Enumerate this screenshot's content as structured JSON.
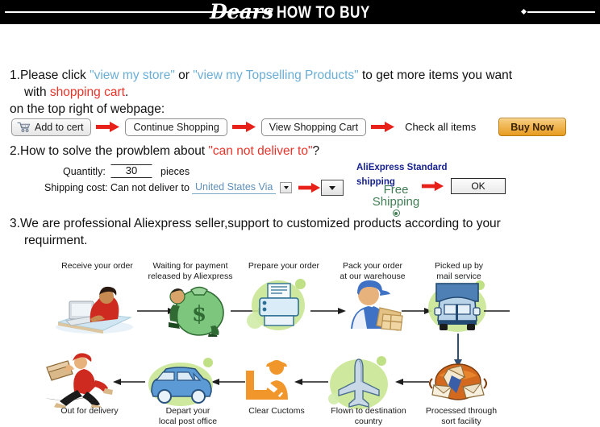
{
  "header": {
    "brand": "Dears",
    "title": "HOW TO BUY",
    "bg_color": "#000000",
    "text_color": "#ffffff"
  },
  "colors": {
    "link_blue": "#6aaed6",
    "accent_red": "#e8332a",
    "buy_now_orange": "#e79b21",
    "green": "#3f7d53",
    "navy": "#16228f"
  },
  "section1": {
    "number": "1.",
    "line1_a": "Please click ",
    "link1": "\"view my store\"",
    "line1_b": " or ",
    "link2": "\"view my Topselling Products\"",
    "line1_c": " to get more items you want",
    "line2_a": "with ",
    "line2_highlight": "shopping cart",
    "line2_b": ".",
    "line3": "on the top right of webpage:",
    "buttons": [
      {
        "label": "Add to cert",
        "icon": "shopping-cart-icon",
        "style": "cart"
      },
      {
        "label": "Continue Shopping",
        "style": "plain"
      },
      {
        "label": "View Shopping Cart",
        "style": "plain"
      },
      {
        "label": "Buy Now",
        "style": "buynow"
      }
    ],
    "check_all_items": "Check all items"
  },
  "section2": {
    "number": "2.",
    "heading_a": "How to solve the prowblem about ",
    "heading_highlight": "\"can not deliver to\"",
    "heading_b": "?",
    "quantity_label": "Quantitly:",
    "quantity_value": "30",
    "pieces_label": "pieces",
    "shipping_label": "Shipping cost: Can not deliver to",
    "country_value": "United States Via",
    "standard_shipping_line1": "AliExpress Standard",
    "standard_shipping_line2": "shipping",
    "free_line1": "Free",
    "free_line2": "Shipping",
    "ok_label": "OK"
  },
  "section3": {
    "number": "3.",
    "line1": "We are professional Aliexpress seller,support to customized products according to your",
    "line2": "requirment."
  },
  "flow": {
    "top_row": [
      {
        "label": "Receive your order",
        "icon": "person-at-computer-icon"
      },
      {
        "label": "Waiting for payment\nreleased by Aliexpress",
        "icon": "money-bag-icon"
      },
      {
        "label": "Prepare your order",
        "icon": "printer-icon"
      },
      {
        "label": "Pack your order\nat our warehouse",
        "icon": "worker-packing-boxes-icon"
      },
      {
        "label": "Picked up by\nmail service",
        "icon": "mail-truck-icon"
      }
    ],
    "bottom_row": [
      {
        "label": "Out for delivery",
        "icon": "running-courier-icon"
      },
      {
        "label": "Depart your\nlocal post office",
        "icon": "delivery-van-icon"
      },
      {
        "label": "Clear Cuctoms",
        "icon": "customs-officer-icon"
      },
      {
        "label": "Flown to destination\ncountry",
        "icon": "airplane-icon"
      },
      {
        "label": "Processed through\nsort facility",
        "icon": "sort-facility-globe-icon"
      }
    ]
  }
}
